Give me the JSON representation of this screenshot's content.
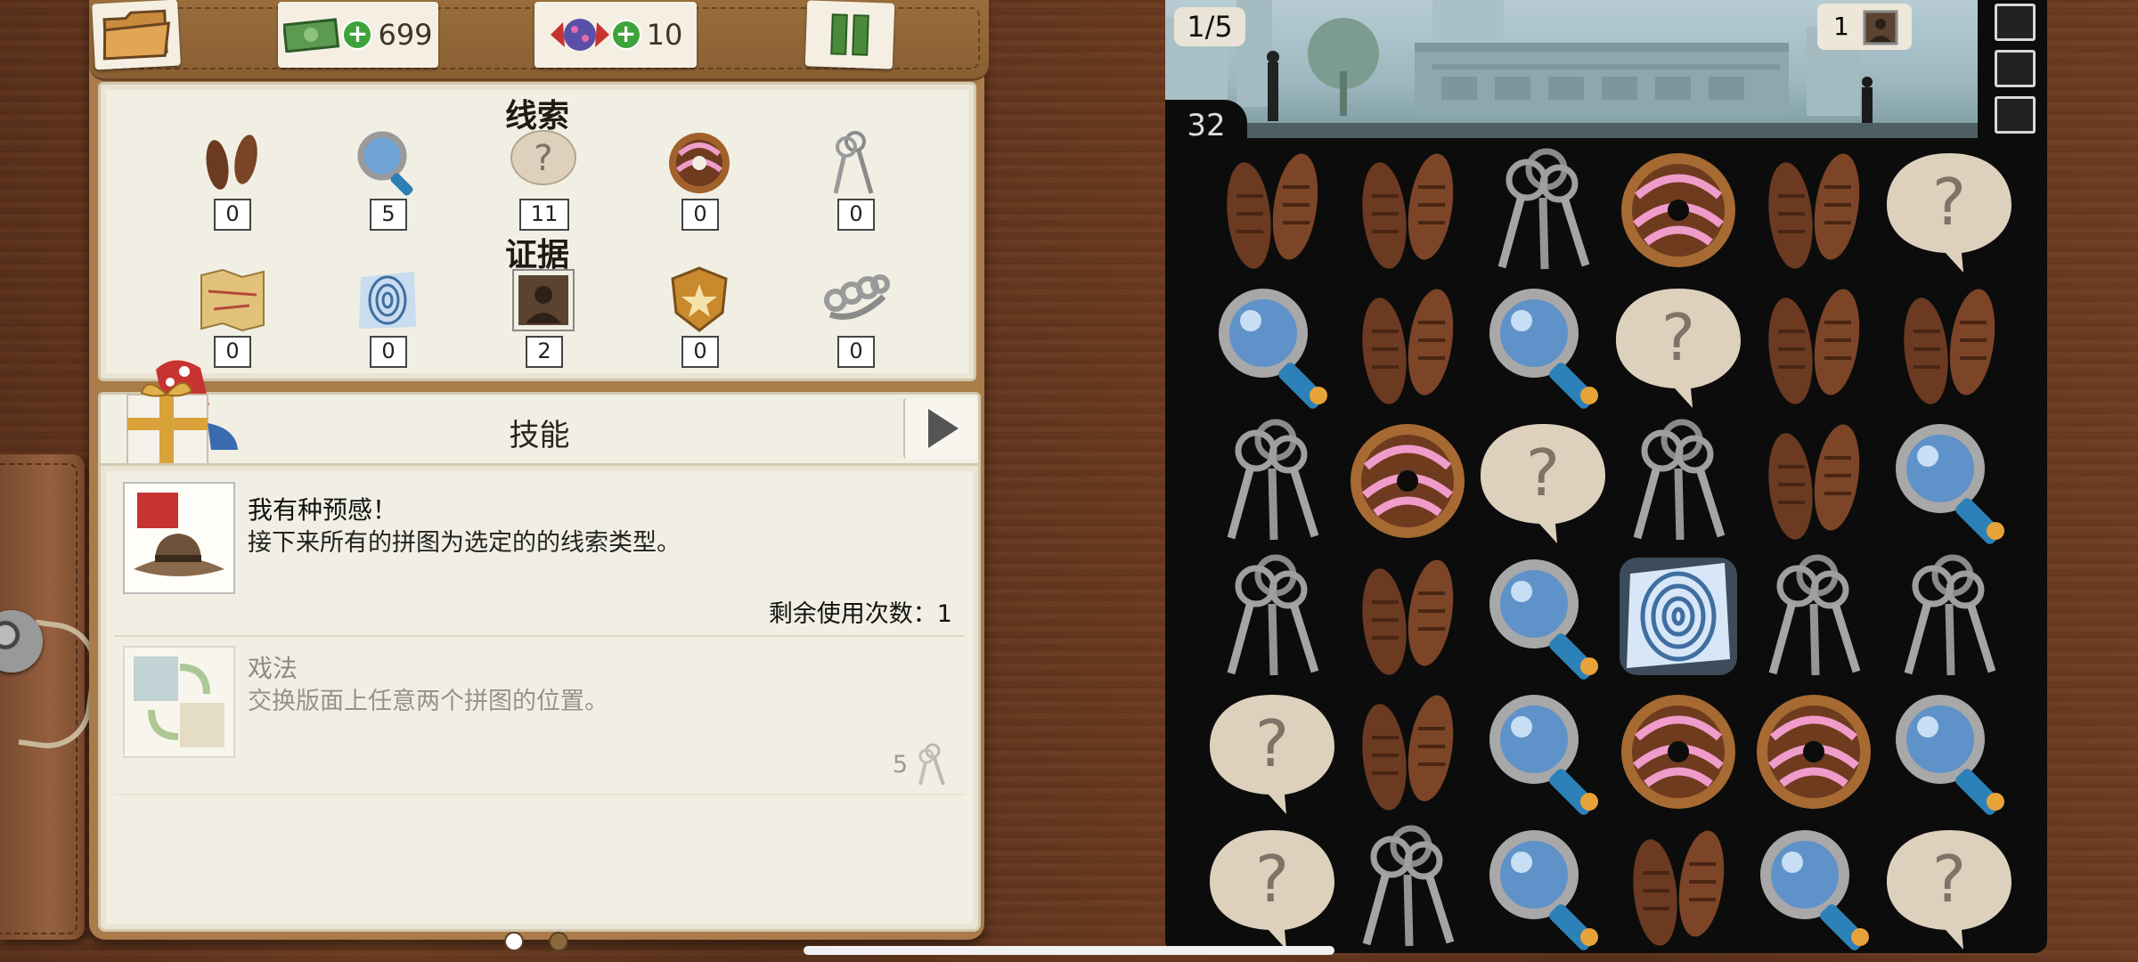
{
  "topbar": {
    "money_count": "699",
    "candy_count": "10"
  },
  "clues": {
    "title": "线索",
    "items": [
      {
        "icon": "footprints-icon",
        "count": "0"
      },
      {
        "icon": "magnifier-icon",
        "count": "5"
      },
      {
        "icon": "question-bubble-icon",
        "count": "11"
      },
      {
        "icon": "donut-icon",
        "count": "0"
      },
      {
        "icon": "keys-icon",
        "count": "0"
      }
    ]
  },
  "evidence": {
    "title": "证据",
    "items": [
      {
        "icon": "map-icon",
        "count": "0"
      },
      {
        "icon": "fingerprint-icon",
        "count": "0"
      },
      {
        "icon": "suspect-photo-icon",
        "count": "2"
      },
      {
        "icon": "badge-icon",
        "count": "0"
      },
      {
        "icon": "brass-knuckles-icon",
        "count": "0"
      }
    ]
  },
  "skills": {
    "title": "技能",
    "list": [
      {
        "name": "我有种预感！",
        "desc": "接下来所有的拼图为选定的的线索类型。",
        "remaining": "剩余使用次数：1"
      },
      {
        "name": "戏法",
        "desc": "交换版面上任意两个拼图的位置。",
        "cost": "5"
      }
    ]
  },
  "game": {
    "progress": "1/5",
    "moves": "32",
    "evidence_count": "1",
    "board": [
      [
        "footprints",
        "footprints",
        "keys",
        "donut",
        "footprints",
        "question"
      ],
      [
        "magnifier",
        "footprints",
        "magnifier",
        "question",
        "footprints",
        "footprints"
      ],
      [
        "keys",
        "donut",
        "question",
        "keys",
        "footprints",
        "magnifier"
      ],
      [
        "keys",
        "footprints",
        "magnifier",
        "fingerprint",
        "keys",
        "keys"
      ],
      [
        "question",
        "footprints",
        "magnifier",
        "donut",
        "donut",
        "magnifier"
      ],
      [
        "question",
        "keys",
        "magnifier",
        "footprints",
        "magnifier",
        "question"
      ]
    ]
  },
  "colors": {
    "wood": "#6b3a20",
    "paper": "#f1efe3",
    "board": "#0c0c0c",
    "accent_green": "#3ea33a"
  }
}
